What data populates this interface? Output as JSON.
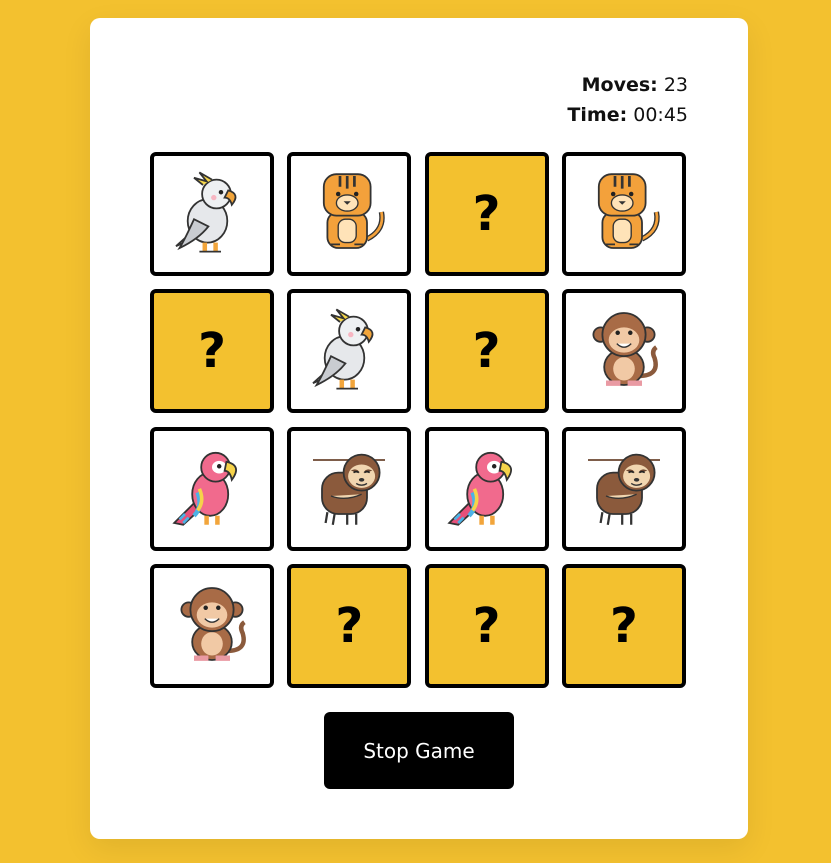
{
  "stats": {
    "moves_label": "Moves:",
    "moves_value": "23",
    "time_label": "Time:",
    "time_value": "00:45"
  },
  "hidden_symbol": "?",
  "cards": [
    {
      "state": "revealed",
      "animal": "cockatoo"
    },
    {
      "state": "revealed",
      "animal": "tiger"
    },
    {
      "state": "hidden",
      "animal": ""
    },
    {
      "state": "revealed",
      "animal": "tiger"
    },
    {
      "state": "hidden",
      "animal": ""
    },
    {
      "state": "revealed",
      "animal": "cockatoo"
    },
    {
      "state": "hidden",
      "animal": ""
    },
    {
      "state": "revealed",
      "animal": "monkey"
    },
    {
      "state": "revealed",
      "animal": "parrot"
    },
    {
      "state": "revealed",
      "animal": "sloth"
    },
    {
      "state": "revealed",
      "animal": "parrot"
    },
    {
      "state": "revealed",
      "animal": "sloth"
    },
    {
      "state": "revealed",
      "animal": "monkey"
    },
    {
      "state": "hidden",
      "animal": ""
    },
    {
      "state": "hidden",
      "animal": ""
    },
    {
      "state": "hidden",
      "animal": ""
    }
  ],
  "stop_button_label": "Stop Game",
  "colors": {
    "background": "#f3c12f",
    "card_hidden": "#f3c12f",
    "button": "#000000"
  }
}
